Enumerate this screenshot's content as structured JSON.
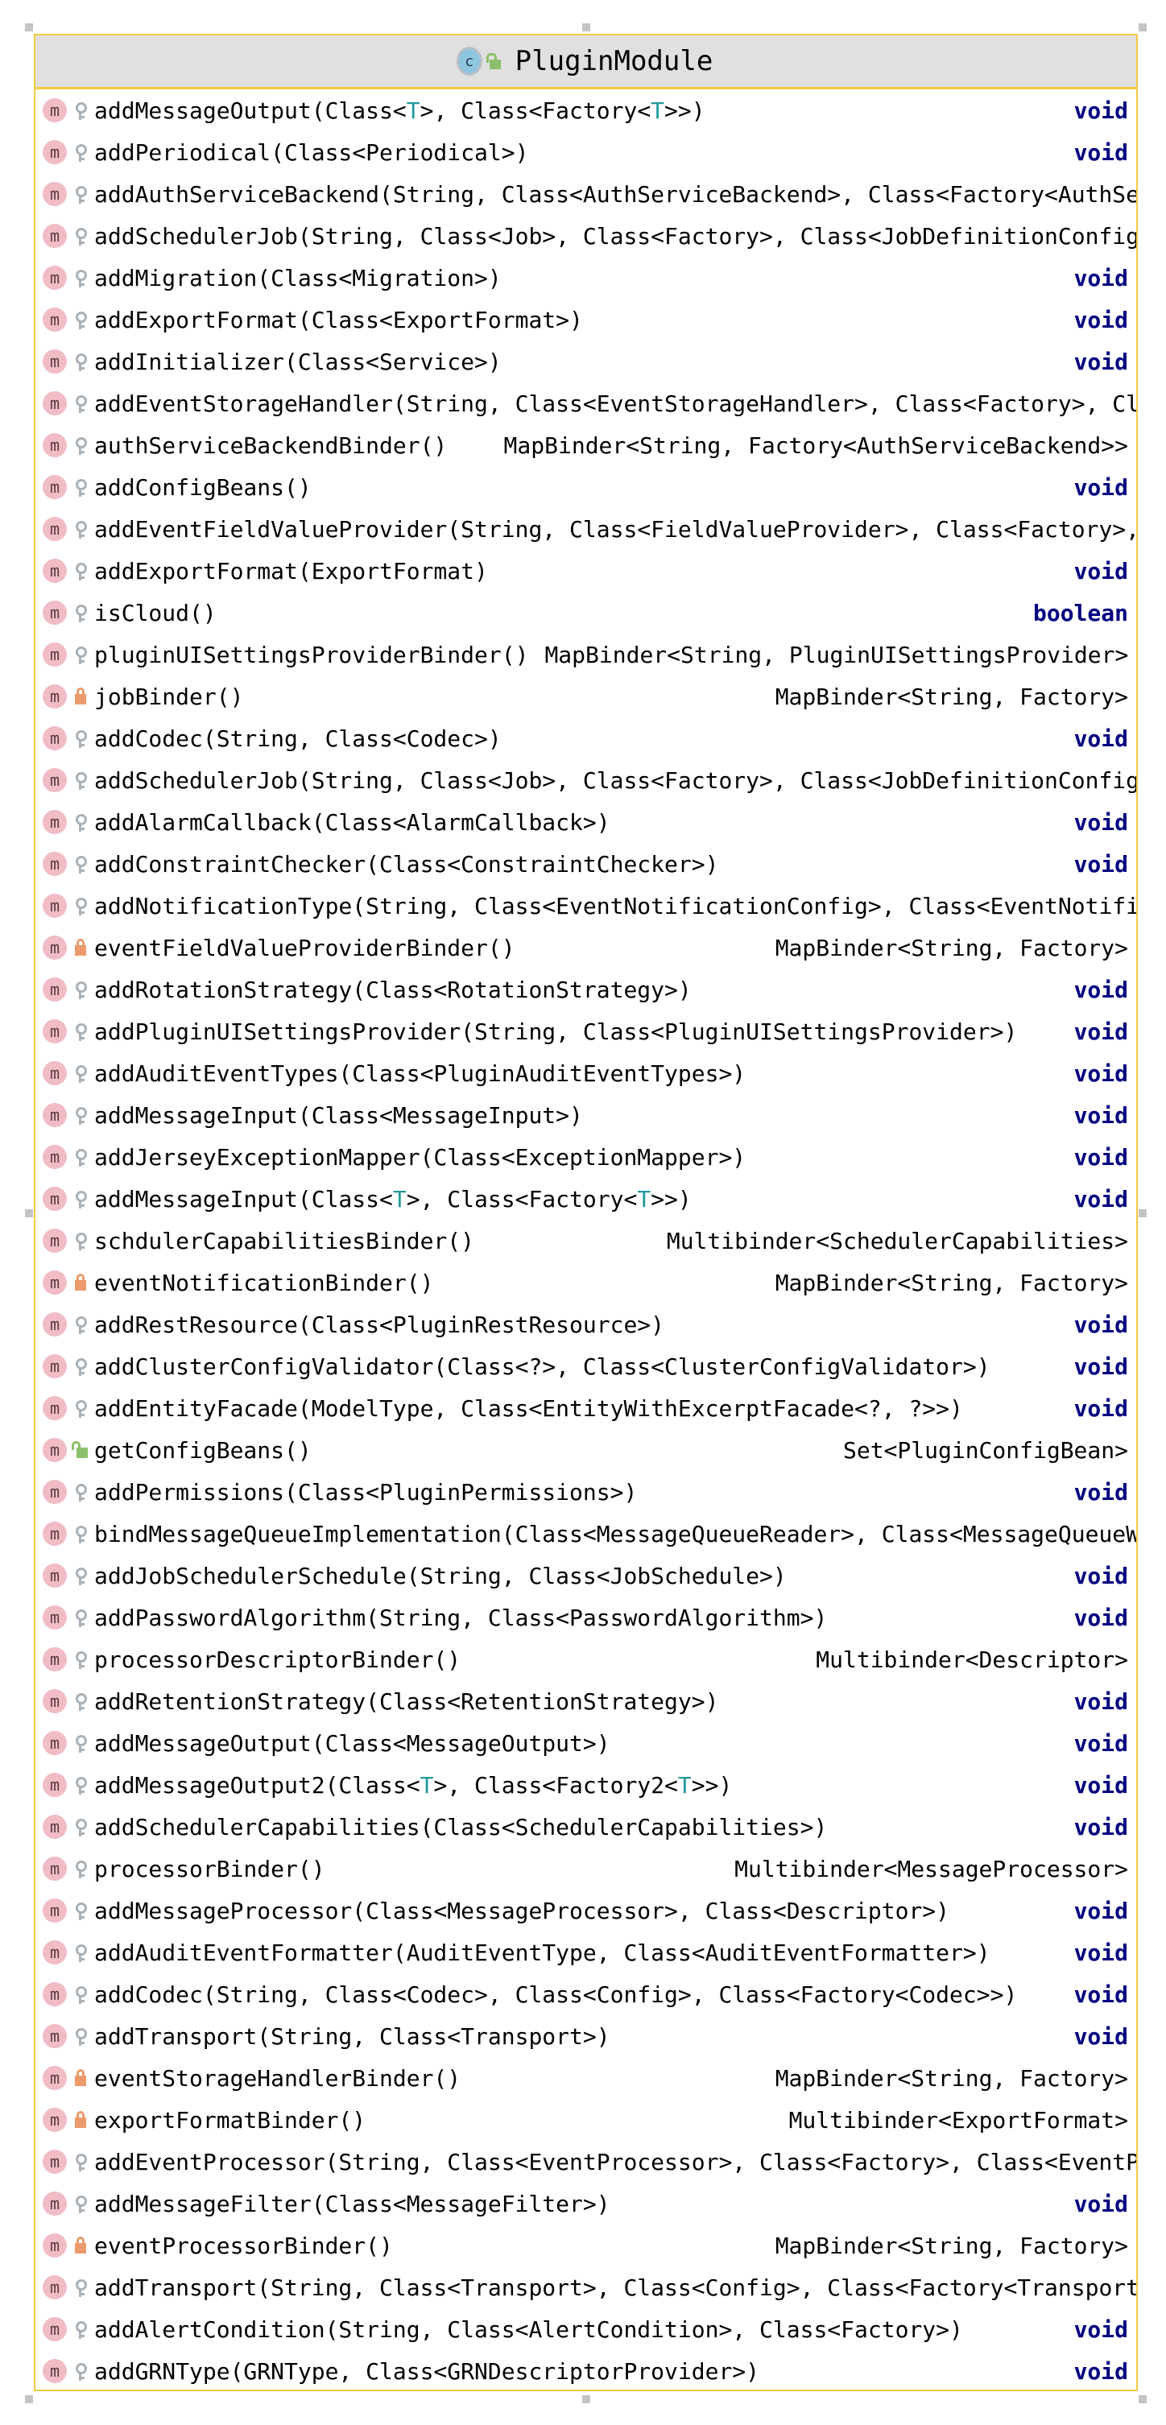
{
  "class": {
    "name": "PluginModule",
    "kind_icon": "class-icon",
    "visibility_icon": "public-unlock-icon"
  },
  "colors": {
    "border": "#f6c944",
    "header_bg": "#e0e0e0",
    "keyword": "#000080",
    "type_param": "#20999d",
    "method_icon": "#f1bcc6",
    "private": "#ec9a6c",
    "public": "#8cbf6a",
    "package": "#a9b1b8"
  },
  "methods": [
    {
      "sig": "addMessageOutput(Class<T>, Class<Factory<T>>)",
      "ret": "void",
      "vis": "package"
    },
    {
      "sig": "addPeriodical(Class<Periodical>)",
      "ret": "void",
      "vis": "package"
    },
    {
      "sig": "addAuthServiceBackend(String, Class<AuthServiceBackend>, Class<Factory<AuthSe",
      "ret": "",
      "vis": "package"
    },
    {
      "sig": "addSchedulerJob(String, Class<Job>, Class<Factory>, Class<JobDefinitionConfig",
      "ret": "",
      "vis": "package"
    },
    {
      "sig": "addMigration(Class<Migration>)",
      "ret": "void",
      "vis": "package"
    },
    {
      "sig": "addExportFormat(Class<ExportFormat>)",
      "ret": "void",
      "vis": "package"
    },
    {
      "sig": "addInitializer(Class<Service>)",
      "ret": "void",
      "vis": "package"
    },
    {
      "sig": "addEventStorageHandler(String, Class<EventStorageHandler>, Class<Factory>, Cl",
      "ret": "",
      "vis": "package"
    },
    {
      "sig": "authServiceBackendBinder()",
      "ret": "MapBinder<String, Factory<AuthServiceBackend>>",
      "vis": "package"
    },
    {
      "sig": "addConfigBeans()",
      "ret": "void",
      "vis": "package"
    },
    {
      "sig": "addEventFieldValueProvider(String, Class<FieldValueProvider>, Class<Factory>,",
      "ret": "",
      "vis": "package"
    },
    {
      "sig": "addExportFormat(ExportFormat)",
      "ret": "void",
      "vis": "package"
    },
    {
      "sig": "isCloud()",
      "ret": "boolean",
      "vis": "package"
    },
    {
      "sig": "pluginUISettingsProviderBinder()",
      "ret": "MapBinder<String, PluginUISettingsProvider>",
      "vis": "package"
    },
    {
      "sig": "jobBinder()",
      "ret": "MapBinder<String, Factory>",
      "vis": "private"
    },
    {
      "sig": "addCodec(String, Class<Codec>)",
      "ret": "void",
      "vis": "package"
    },
    {
      "sig": "addSchedulerJob(String, Class<Job>, Class<Factory>, Class<JobDefinitionConfig",
      "ret": "",
      "vis": "package"
    },
    {
      "sig": "addAlarmCallback(Class<AlarmCallback>)",
      "ret": "void",
      "vis": "package"
    },
    {
      "sig": "addConstraintChecker(Class<ConstraintChecker>)",
      "ret": "void",
      "vis": "package"
    },
    {
      "sig": "addNotificationType(String, Class<EventNotificationConfig>, Class<EventNotifi",
      "ret": "",
      "vis": "package"
    },
    {
      "sig": "eventFieldValueProviderBinder()",
      "ret": "MapBinder<String, Factory>",
      "vis": "private"
    },
    {
      "sig": "addRotationStrategy(Class<RotationStrategy>)",
      "ret": "void",
      "vis": "package"
    },
    {
      "sig": "addPluginUISettingsProvider(String, Class<PluginUISettingsProvider>)",
      "ret": "void",
      "vis": "package"
    },
    {
      "sig": "addAuditEventTypes(Class<PluginAuditEventTypes>)",
      "ret": "void",
      "vis": "package"
    },
    {
      "sig": "addMessageInput(Class<MessageInput>)",
      "ret": "void",
      "vis": "package"
    },
    {
      "sig": "addJerseyExceptionMapper(Class<ExceptionMapper>)",
      "ret": "void",
      "vis": "package"
    },
    {
      "sig": "addMessageInput(Class<T>, Class<Factory<T>>)",
      "ret": "void",
      "vis": "package"
    },
    {
      "sig": "schdulerCapabilitiesBinder()",
      "ret": "Multibinder<SchedulerCapabilities>",
      "vis": "package"
    },
    {
      "sig": "eventNotificationBinder()",
      "ret": "MapBinder<String, Factory>",
      "vis": "private"
    },
    {
      "sig": "addRestResource(Class<PluginRestResource>)",
      "ret": "void",
      "vis": "package"
    },
    {
      "sig": "addClusterConfigValidator(Class<?>, Class<ClusterConfigValidator>)",
      "ret": "void",
      "vis": "package"
    },
    {
      "sig": "addEntityFacade(ModelType, Class<EntityWithExcerptFacade<?, ?>>)",
      "ret": "void",
      "vis": "package"
    },
    {
      "sig": "getConfigBeans()",
      "ret": "Set<PluginConfigBean>",
      "vis": "public"
    },
    {
      "sig": "addPermissions(Class<PluginPermissions>)",
      "ret": "void",
      "vis": "package"
    },
    {
      "sig": "bindMessageQueueImplementation(Class<MessageQueueReader>, Class<MessageQueueW",
      "ret": "",
      "vis": "package"
    },
    {
      "sig": "addJobSchedulerSchedule(String, Class<JobSchedule>)",
      "ret": "void",
      "vis": "package"
    },
    {
      "sig": "addPasswordAlgorithm(String, Class<PasswordAlgorithm>)",
      "ret": "void",
      "vis": "package"
    },
    {
      "sig": "processorDescriptorBinder()",
      "ret": "Multibinder<Descriptor>",
      "vis": "package"
    },
    {
      "sig": "addRetentionStrategy(Class<RetentionStrategy>)",
      "ret": "void",
      "vis": "package"
    },
    {
      "sig": "addMessageOutput(Class<MessageOutput>)",
      "ret": "void",
      "vis": "package"
    },
    {
      "sig": "addMessageOutput2(Class<T>, Class<Factory2<T>>)",
      "ret": "void",
      "vis": "package"
    },
    {
      "sig": "addSchedulerCapabilities(Class<SchedulerCapabilities>)",
      "ret": "void",
      "vis": "package"
    },
    {
      "sig": "processorBinder()",
      "ret": "Multibinder<MessageProcessor>",
      "vis": "package"
    },
    {
      "sig": "addMessageProcessor(Class<MessageProcessor>, Class<Descriptor>)",
      "ret": "void",
      "vis": "package"
    },
    {
      "sig": "addAuditEventFormatter(AuditEventType, Class<AuditEventFormatter>)",
      "ret": "void",
      "vis": "package"
    },
    {
      "sig": "addCodec(String, Class<Codec>, Class<Config>, Class<Factory<Codec>>)",
      "ret": "void",
      "vis": "package"
    },
    {
      "sig": "addTransport(String, Class<Transport>)",
      "ret": "void",
      "vis": "package"
    },
    {
      "sig": "eventStorageHandlerBinder()",
      "ret": "MapBinder<String, Factory>",
      "vis": "private"
    },
    {
      "sig": "exportFormatBinder()",
      "ret": "Multibinder<ExportFormat>",
      "vis": "private"
    },
    {
      "sig": "addEventProcessor(String, Class<EventProcessor>, Class<Factory>, Class<EventP",
      "ret": "",
      "vis": "package"
    },
    {
      "sig": "addMessageFilter(Class<MessageFilter>)",
      "ret": "void",
      "vis": "package"
    },
    {
      "sig": "eventProcessorBinder()",
      "ret": "MapBinder<String, Factory>",
      "vis": "private"
    },
    {
      "sig": "addTransport(String, Class<Transport>, Class<Config>, Class<Factory<Transport",
      "ret": "",
      "vis": "package"
    },
    {
      "sig": "addAlertCondition(String, Class<AlertCondition>, Class<Factory>)",
      "ret": "void",
      "vis": "package"
    },
    {
      "sig": "addGRNType(GRNType, Class<GRNDescriptorProvider>)",
      "ret": "void",
      "vis": "package"
    }
  ]
}
